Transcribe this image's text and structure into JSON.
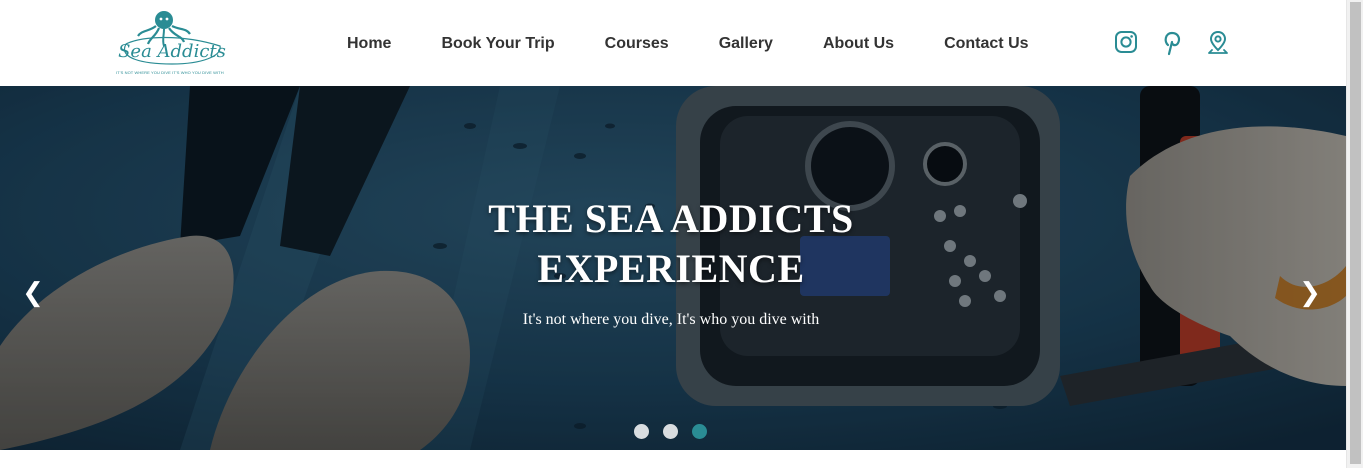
{
  "brand": {
    "logo_text": "Sea Addicts",
    "tagline": "IT'S NOT WHERE YOU DIVE IT'S WHO YOU DIVE WITH",
    "logo_icon": "octopus-icon",
    "color": "#2a8c94"
  },
  "nav": {
    "items": [
      {
        "label": "Home"
      },
      {
        "label": "Book Your Trip"
      },
      {
        "label": "Courses"
      },
      {
        "label": "Gallery"
      },
      {
        "label": "About Us"
      },
      {
        "label": "Contact Us"
      }
    ],
    "text_color": "#333333"
  },
  "social": {
    "icons": [
      "instagram-icon",
      "pinterest-icon",
      "location-icon"
    ],
    "color": "#2a8c94"
  },
  "hero": {
    "title_line1": "THE SEA ADDICTS",
    "title_line2": "EXPERIENCE",
    "subtitle": "It's not where you dive, It's who you dive with",
    "prev_arrow": "❮",
    "next_arrow": "❯",
    "slide_count": 3,
    "active_slide": 3,
    "dot_color": "#d9dde0",
    "dot_active_color": "#2a8c94"
  }
}
